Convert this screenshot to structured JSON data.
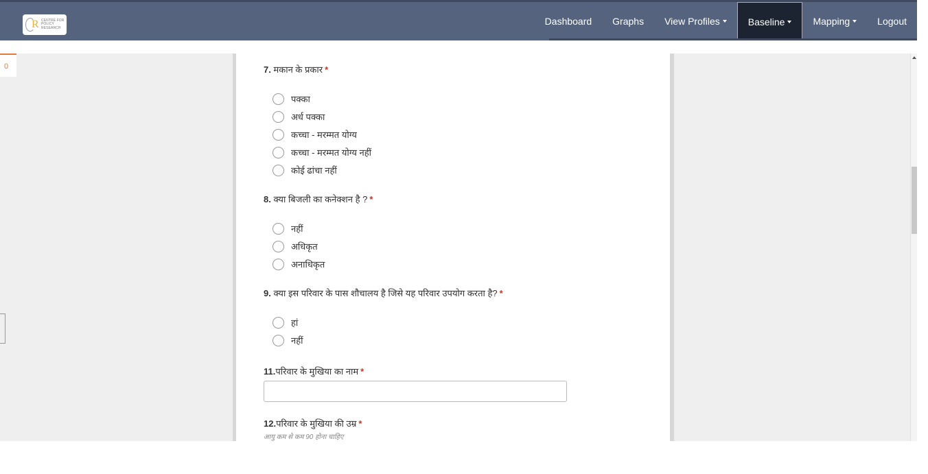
{
  "header": {
    "logo_text": [
      "CENTRE FOR",
      "POLICY",
      "RESEARCH"
    ],
    "nav": [
      {
        "label": "Dashboard",
        "dropdown": false,
        "active": false
      },
      {
        "label": "Graphs",
        "dropdown": false,
        "active": false
      },
      {
        "label": "View Profiles",
        "dropdown": true,
        "active": false
      },
      {
        "label": "Baseline",
        "dropdown": true,
        "active": true
      },
      {
        "label": "Mapping",
        "dropdown": true,
        "active": false
      },
      {
        "label": "Logout",
        "dropdown": false,
        "active": false
      }
    ]
  },
  "left_panel": {
    "tab_label": "0"
  },
  "questions": {
    "q7": {
      "num": "7.",
      "label": "मकान के प्रकार",
      "required": "*",
      "options": [
        "पक्का",
        "अर्ध पक्का",
        "कच्चा - मरम्मत योग्य",
        "कच्चा - मरम्मत योग्य नहीं",
        "कोई ढांचा नहीं"
      ]
    },
    "q8": {
      "num": "8.",
      "label": "क्या बिजली का कनेक्शन है ?",
      "required": "*",
      "options": [
        "नहीं",
        "अधिकृत",
        "अनाधिकृत"
      ]
    },
    "q9": {
      "num": "9.",
      "label": "क्या इस परिवार के पास शौचालय है जिसे यह परिवार उपयोग करता है?",
      "required": "*",
      "options": [
        "हां",
        "नहीं"
      ]
    },
    "q11": {
      "num": "11.",
      "label": "परिवार के मुखिया का नाम",
      "required": "*",
      "value": "",
      "placeholder": ""
    },
    "q12": {
      "num": "12.",
      "label": "परिवार के मुखिया की उम्र",
      "required": "*",
      "hint": "आयु कम से कम 90 होना चाहिए"
    }
  },
  "colors": {
    "navbar": "#55637f",
    "nav_active": "#1c2432",
    "required": "#c0392b",
    "tab_accent": "#e07b39"
  }
}
